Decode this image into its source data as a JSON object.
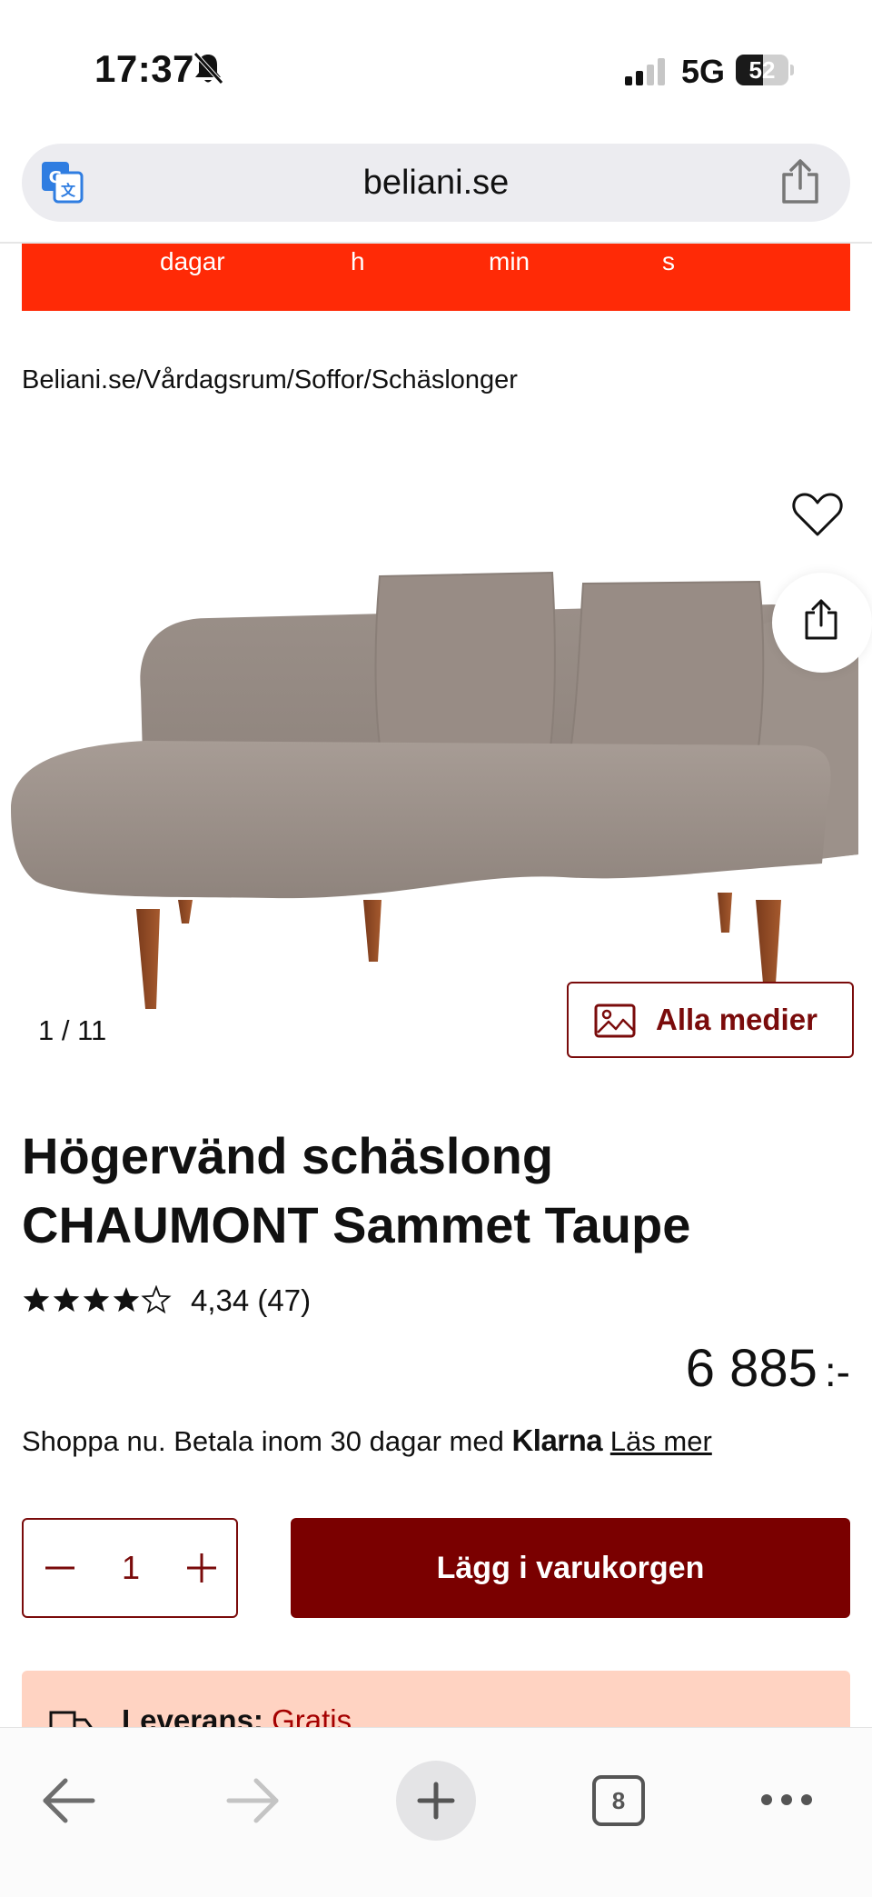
{
  "status_bar": {
    "time": "17:37",
    "network": "5G",
    "battery_level": "52",
    "battery_fraction": 0.52
  },
  "browser": {
    "url": "beliani.se",
    "tabs_count": "8"
  },
  "countdown": {
    "labels": [
      "dagar",
      "h",
      "min",
      "s"
    ],
    "background_color": "#ff2a06"
  },
  "breadcrumb": "Beliani.se/Vårdagsrum/Soffor/Schäslonger",
  "gallery": {
    "counter": "1 /  11",
    "media_button_label": "Alla medier"
  },
  "product": {
    "title": "Högervänd schäslong CHAUMONT Sammet Taupe",
    "rating_value": 4.34,
    "rating_text": "4,34 (47)",
    "price": "6 885",
    "currency": ":-"
  },
  "payment": {
    "text": "Shoppa nu. Betala inom 30 dagar med",
    "klarna": "Klarna",
    "link": "Läs mer"
  },
  "cart": {
    "quantity": "1",
    "add_to_cart_label": "Lägg i varukorgen"
  },
  "delivery": {
    "label": "Leverans:",
    "value": "Gratis"
  },
  "colors": {
    "brand_dark_red": "#7a0000",
    "countdown_red": "#ff2a06",
    "delivery_bg": "#ffd3c2"
  }
}
